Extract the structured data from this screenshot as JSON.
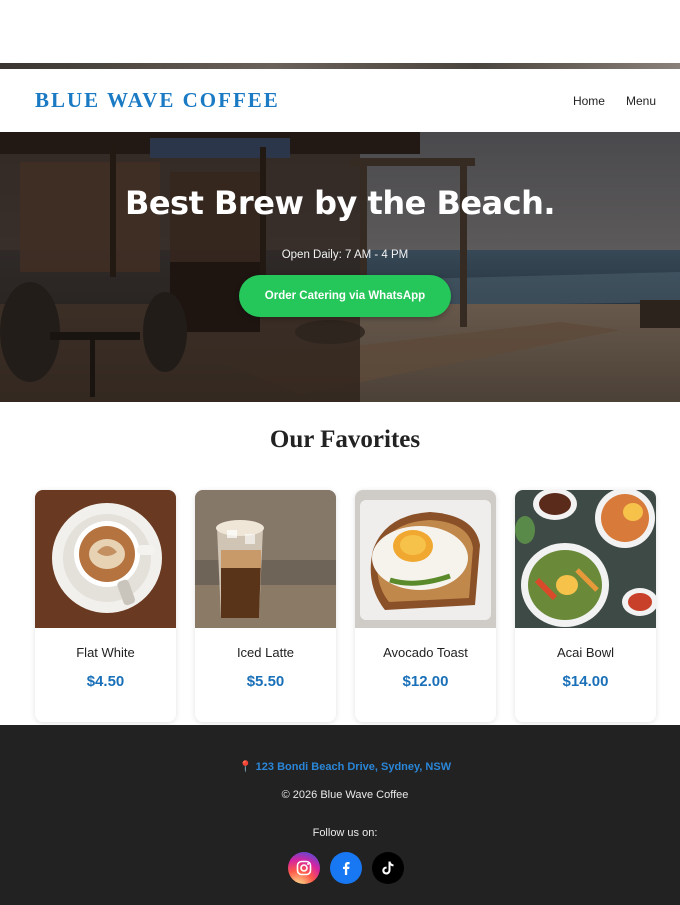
{
  "header": {
    "logo": "BLUE WAVE COFFEE",
    "nav": [
      "Home",
      "Menu"
    ]
  },
  "hero": {
    "title": "Best Brew by the Beach.",
    "hours": "Open Daily: 7 AM - 4 PM",
    "cta": "Order Catering via WhatsApp"
  },
  "favorites": {
    "title": "Our Favorites",
    "items": [
      {
        "name": "Flat White",
        "price": "$4.50",
        "image": "latte-art-cup"
      },
      {
        "name": "Iced Latte",
        "price": "$5.50",
        "image": "iced-latte-glass"
      },
      {
        "name": "Avocado Toast",
        "price": "$12.00",
        "image": "avocado-toast-with-egg"
      },
      {
        "name": "Acai Bowl",
        "price": "$14.00",
        "image": "bowls-of-food"
      }
    ]
  },
  "footer": {
    "address": "123 Bondi Beach Drive, Sydney, NSW",
    "copyright": "© 2026 Blue Wave Coffee",
    "follow": "Follow us on:",
    "socials": [
      "instagram-icon",
      "facebook-icon",
      "tiktok-icon"
    ]
  },
  "colors": {
    "brand": "#1a7ac4",
    "cta": "#25c65a",
    "price": "#1a70b8",
    "footer_bg": "#222222"
  }
}
